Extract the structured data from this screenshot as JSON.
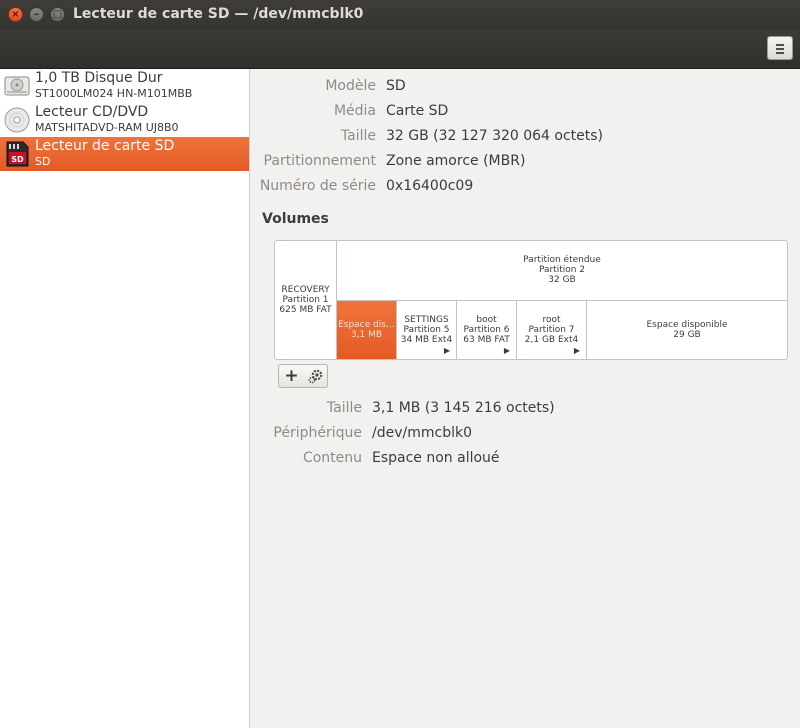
{
  "window": {
    "title": "Lecteur de carte SD — /dev/mmcblk0",
    "close_glyph": "×",
    "minimize_glyph": "–",
    "maximize_glyph": "□"
  },
  "header": {
    "menu_icon": "hamburger-menu-icon"
  },
  "sidebar": {
    "drives": [
      {
        "name": "1,0 TB Disque Dur",
        "sub": "ST1000LM024 HN-M101MBB",
        "icon": "hard-disk-icon",
        "selected": false
      },
      {
        "name": "Lecteur CD/DVD",
        "sub": "MATSHITADVD-RAM UJ8B0",
        "icon": "optical-disc-icon",
        "selected": false
      },
      {
        "name": "Lecteur de carte SD",
        "sub": "SD",
        "icon": "sd-card-icon",
        "selected": true
      }
    ]
  },
  "drive_info": {
    "model_label": "Modèle",
    "model": "SD",
    "media_label": "Média",
    "media": "Carte SD",
    "size_label": "Taille",
    "size": "32 GB (32 127 320 064 octets)",
    "partitioning_label": "Partitionnement",
    "partitioning": "Zone amorce (MBR)",
    "serial_label": "Numéro de série",
    "serial": "0x16400c09"
  },
  "volumes": {
    "title": "Volumes",
    "extended": {
      "name": "Partition étendue",
      "number": "Partition 2",
      "size": "32 GB"
    },
    "recovery": {
      "name": "RECOVERY",
      "number": "Partition 1",
      "size": "625 MB FAT"
    },
    "cells": [
      {
        "name": "Espace dis…",
        "number": "3,1 MB",
        "size": "",
        "has_arrow": false,
        "selected": true
      },
      {
        "name": "SETTINGS",
        "number": "Partition 5",
        "size": "34 MB Ext4",
        "has_arrow": true,
        "selected": false
      },
      {
        "name": "boot",
        "number": "Partition 6",
        "size": "63 MB FAT",
        "has_arrow": true,
        "selected": false
      },
      {
        "name": "root",
        "number": "Partition 7",
        "size": "2,1 GB Ext4",
        "has_arrow": true,
        "selected": false
      },
      {
        "name": "Espace disponible",
        "number": "29 GB",
        "size": "",
        "has_arrow": false,
        "selected": false
      }
    ],
    "arrow_glyph": "▶",
    "add_button": "+",
    "settings_icon": "gear-icon"
  },
  "selection_info": {
    "size_label": "Taille",
    "size": "3,1 MB (3 145 216 octets)",
    "device_label": "Périphérique",
    "device": "/dev/mmcblk0",
    "content_label": "Contenu",
    "content": "Espace non alloué"
  },
  "colors": {
    "accent": "#e95420",
    "titlebar": "#3c3b37",
    "sidebar_bg": "#ffffff",
    "main_bg": "#f2f1f0"
  }
}
